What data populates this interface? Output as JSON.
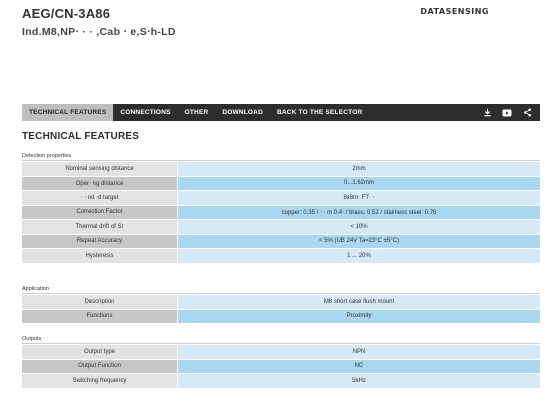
{
  "header": {
    "model_code": "AEG/CN-3A86",
    "product_name": "Ind.M8,NP‧ · · ,Cab ‧ e,S‧h-LD",
    "brand": "DATASENSING"
  },
  "tabs": [
    {
      "label": "TECHNICAL FEATURES",
      "active": true
    },
    {
      "label": "CONNECTIONS",
      "active": false
    },
    {
      "label": "OTHER",
      "active": false
    },
    {
      "label": "DOWNLOAD",
      "active": false
    },
    {
      "label": "BACK TO THE SELECTOR",
      "active": false
    }
  ],
  "tab_icons": [
    "download-icon",
    "video-icon",
    "share-icon"
  ],
  "section_title": "TECHNICAL FEATURES",
  "groups": [
    {
      "label": "Detection properties",
      "rows": [
        {
          "key": "Nominal sensing distance",
          "value": "2mm"
        },
        {
          "key": "Oper‧ ng distance",
          "value": "0...1.62mm"
        },
        {
          "key": "‧ ‧ nd ‧d target",
          "value": "8x8m‧ FT‧ ‧"
        },
        {
          "key": "Correction Factor",
          "value": "copper: 0.35 / ‧ ‧ m 0.4‧ / brass: 0.52 / stainless steel: 0.76"
        },
        {
          "key": "Thermal drift of Sr",
          "value": "< 10%"
        },
        {
          "key": "Repeat Accuracy",
          "value": "< 5% (UB 24V Ta=23°C ±5°C)"
        },
        {
          "key": "Hysteresis",
          "value": "1 ... 20%"
        }
      ]
    },
    {
      "label": "Application",
      "rows": [
        {
          "key": "Description",
          "value": "M8 short case flush mount"
        },
        {
          "key": "Functions",
          "value": "Proximity"
        }
      ]
    },
    {
      "label": "Outputs",
      "rows": [
        {
          "key": "Output type",
          "value": "NPN"
        },
        {
          "key": "Output Function",
          "value": "NC"
        },
        {
          "key": "Switching frequency",
          "value": "5kHz"
        }
      ]
    }
  ]
}
